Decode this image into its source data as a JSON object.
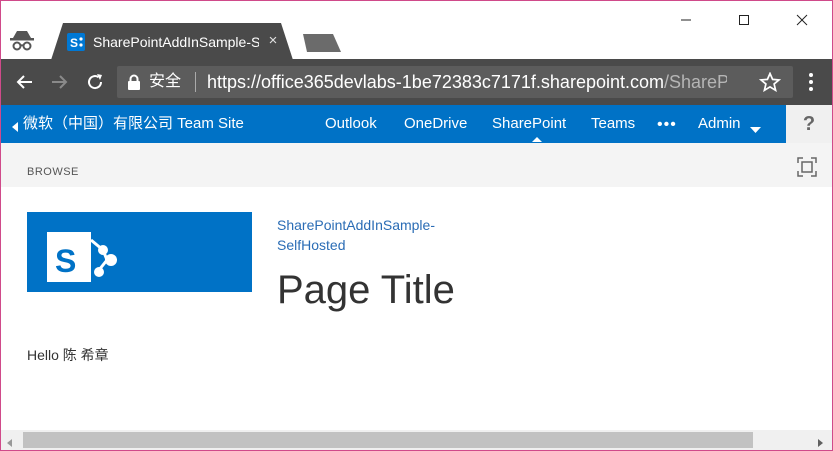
{
  "browser": {
    "tab": {
      "title": "SharePointAddInSample-SelfHosted",
      "close_glyph": "×",
      "favicon": "sharepoint-icon"
    },
    "security_label": "安全",
    "url_main": "https://office365devlabs-1be72383c7171f.sharepoint.com",
    "url_rest": "/SharePointAddInSample-SelfHosted",
    "icons": {
      "incognito": "incognito-icon",
      "back": "back-arrow-icon",
      "forward": "forward-arrow-icon",
      "reload": "reload-icon",
      "lock": "lock-icon",
      "star": "star-icon",
      "menu": "more-vertical-icon"
    }
  },
  "suitebar": {
    "site_name": "微软（中国）有限公司 Team Site",
    "links": [
      {
        "label": "Outlook",
        "active": false
      },
      {
        "label": "OneDrive",
        "active": false
      },
      {
        "label": "SharePoint",
        "active": true
      },
      {
        "label": "Teams",
        "active": false
      }
    ],
    "more_label": "•••",
    "admin_label": "Admin",
    "help_label": "?",
    "color": "#0072c6"
  },
  "ribbon": {
    "browse_label": "BROWSE"
  },
  "content": {
    "site_link": "SharePointAddInSample-SelfHosted",
    "page_title": "Page Title",
    "greeting": "Hello 陈 希章"
  }
}
